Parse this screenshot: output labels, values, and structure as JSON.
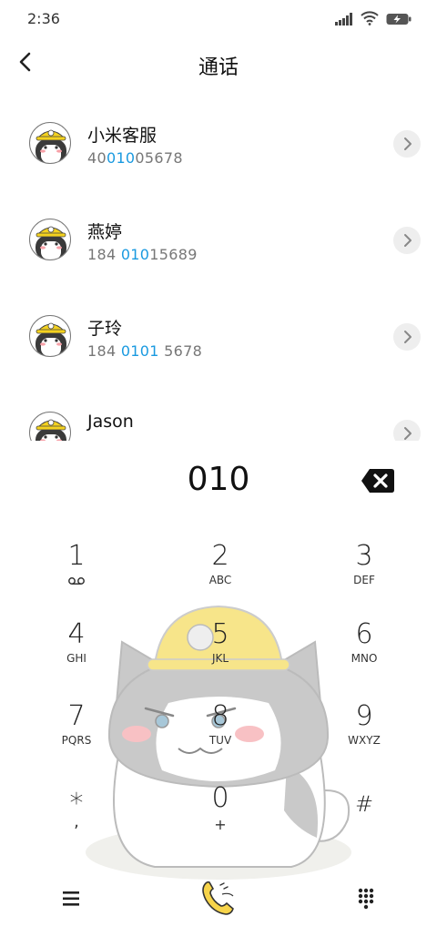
{
  "status": {
    "time": "2:36"
  },
  "header": {
    "title": "通话"
  },
  "contacts": [
    {
      "name": "小米客服",
      "number_pre": "40",
      "number_hl": "010",
      "number_post": "05678"
    },
    {
      "name": "燕婷",
      "number_pre": "184 ",
      "number_hl": "010",
      "number_post": "15689"
    },
    {
      "name": "子玲",
      "number_pre": "184 ",
      "number_hl": "0101",
      "number_post": " 5678"
    },
    {
      "name": "Jason",
      "number_pre": "",
      "number_hl": "",
      "number_post": ""
    }
  ],
  "dial": {
    "value": "010"
  },
  "keypad": [
    {
      "digit": "1",
      "letters": ""
    },
    {
      "digit": "2",
      "letters": "ABC"
    },
    {
      "digit": "3",
      "letters": "DEF"
    },
    {
      "digit": "4",
      "letters": "GHI"
    },
    {
      "digit": "5",
      "letters": "JKL"
    },
    {
      "digit": "6",
      "letters": "MNO"
    },
    {
      "digit": "7",
      "letters": "PQRS"
    },
    {
      "digit": "8",
      "letters": "TUV"
    },
    {
      "digit": "9",
      "letters": "WXYZ"
    },
    {
      "digit": "*",
      "letters": ","
    },
    {
      "digit": "0",
      "letters": "+"
    },
    {
      "digit": "#",
      "letters": ""
    }
  ],
  "icons": {
    "back": "chevron-left-icon",
    "backspace": "backspace-icon",
    "voicemail": "voicemail-icon",
    "menu": "menu-icon",
    "call": "call-icon",
    "dialpad": "dialpad-icon"
  },
  "colors": {
    "highlight": "#1a9ae0",
    "helmet": "#f7e58a"
  }
}
